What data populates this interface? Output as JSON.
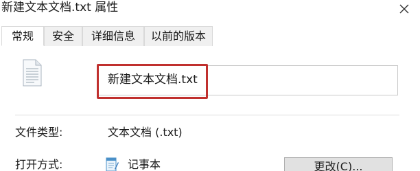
{
  "window": {
    "title": "新建文本文档.txt 属性",
    "close_symbol": "×"
  },
  "tabs": [
    {
      "label": "常规",
      "active": true
    },
    {
      "label": "安全",
      "active": false
    },
    {
      "label": "详细信息",
      "active": false
    },
    {
      "label": "以前的版本",
      "active": false
    }
  ],
  "general": {
    "file_icon": "text-document-icon",
    "file_name": "新建文本文档.txt",
    "highlight_color": "#c0302e",
    "file_type_label": "文件类型:",
    "file_type_value": "文本文档 (.txt)",
    "opens_with_label": "打开方式:",
    "opens_with_icon": "notepad-icon",
    "opens_with_value": "记事本",
    "change_button": "更改(C)..."
  }
}
